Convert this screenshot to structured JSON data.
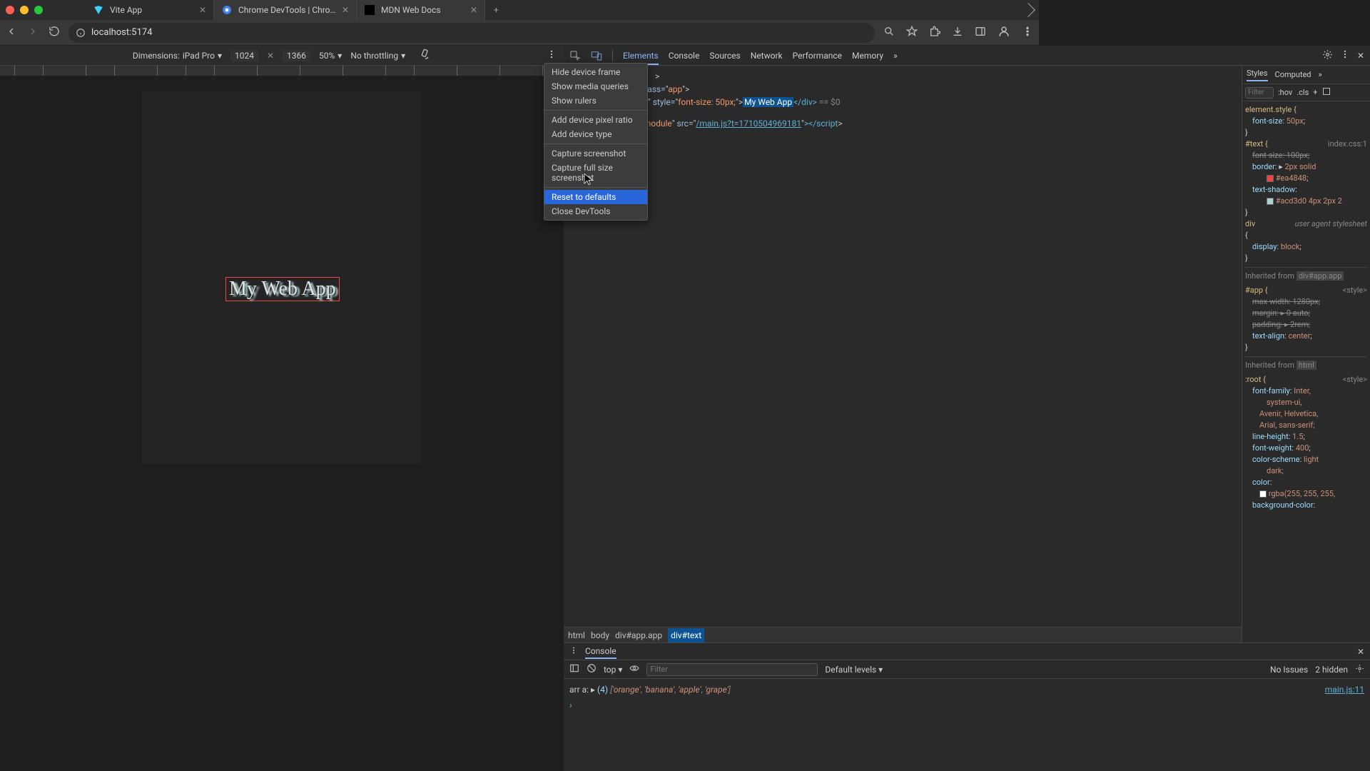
{
  "tabs": [
    {
      "label": "Vite App",
      "active": true,
      "favicon": "vite"
    },
    {
      "label": "Chrome DevTools | Chrome",
      "active": false,
      "favicon": "chrome"
    },
    {
      "label": "MDN Web Docs",
      "active": false,
      "favicon": "mdn"
    }
  ],
  "url": "localhost:5174",
  "device_toolbar": {
    "dimensions_label": "Dimensions:",
    "device": "iPad Pro",
    "width": "1024",
    "height": "1366",
    "zoom": "50%",
    "throttling": "No throttling"
  },
  "app_text": "My Web App",
  "context_menu": {
    "items": [
      "Hide device frame",
      "Show media queries",
      "Show rulers"
    ],
    "items2": [
      "Add device pixel ratio",
      "Add device type"
    ],
    "items3": [
      "Capture screenshot",
      "Capture full size screenshot"
    ],
    "items4": [
      "Reset to defaults",
      "Close DevTools"
    ],
    "highlighted": "Reset to defaults"
  },
  "devtools_tabs": [
    "Elements",
    "Console",
    "Sources",
    "Network",
    "Performance",
    "Memory"
  ],
  "active_devtools_tab": "Elements",
  "dom": {
    "l1": "class=",
    "l1v": "app",
    "l2_style_attr": "style=",
    "l2_style_val": "font-size: 50px;",
    "l2_text": "My Web App",
    "l2_end": "</div>",
    "l2_marker": " == $0",
    "l3_type_attr": "module",
    "l3_src_attr": "src=",
    "l3_src_val": "/main.js?t=1710504969181",
    "l3_close": "></script"
  },
  "breadcrumb": [
    "html",
    "body",
    "div#app.app",
    "div#text"
  ],
  "styles": {
    "tabs": [
      "Styles",
      "Computed"
    ],
    "filter_ph": "Filter",
    "hov": ":hov",
    "cls": ".cls",
    "elstyle_label": "element.style {",
    "elstyle_rule": "font-size: 50px;",
    "text_sel": "#text {",
    "text_src": "index.css:1",
    "text_r1": "font-size: 100px;",
    "text_r2": "border: ▸ 2px solid",
    "text_c1": "#ea4848",
    "text_r3": "text-shadow:",
    "text_c2": "#acd3d0 4px 2px 2",
    "div_sel": "div",
    "div_src": "user agent stylesheet",
    "div_r1": "display: block;",
    "inh1": "Inherited from",
    "inh1_sel": "div#app.app",
    "app_sel": "#app {",
    "app_src": "<style>",
    "app_r1": "max-width: 1280px;",
    "app_r2": "margin: ▸ 0 auto;",
    "app_r3": "padding: ▸ 2rem;",
    "app_r4": "text-align: center;",
    "inh2": "Inherited from",
    "inh2_sel": "html",
    "root_sel": ":root {",
    "root_src": "<style>",
    "root_r1": "font-family: Inter,",
    "root_r1b": "system-ui,",
    "root_r1c": "Avenir, Helvetica,",
    "root_r1d": "Arial, sans-serif;",
    "root_r2": "line-height: 1.5;",
    "root_r3": "font-weight: 400;",
    "root_r4": "color-scheme: light",
    "root_r4b": "dark;",
    "root_r5": "color:",
    "root_c1": "rgba(255, 255, 255,",
    "root_r6": "background-color:"
  },
  "console": {
    "tab": "Console",
    "context": "top",
    "filter_ph": "Filter",
    "levels": "Default levels",
    "issues": "No Issues",
    "hidden": "2 hidden",
    "log_prefix": "arr a: ",
    "log_count": "(4)",
    "log_arr": "['orange', 'banana', 'apple', 'grape']",
    "log_src": "main.js:11"
  }
}
